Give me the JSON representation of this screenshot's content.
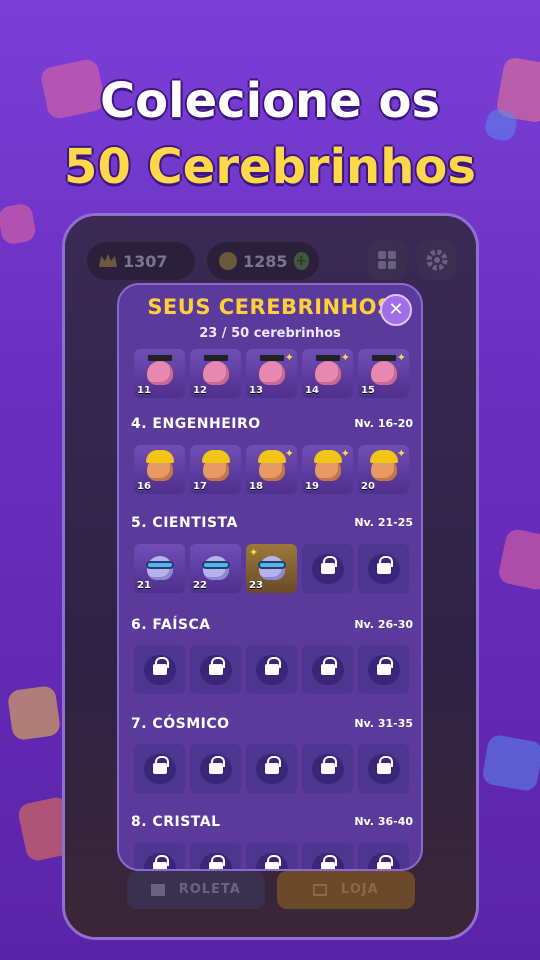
{
  "headline": {
    "line1": "Colecione os",
    "line2": "50 Cerebrinhos"
  },
  "game": {
    "trophies": "1307",
    "coins": "1285",
    "menu_icon": "grid-icon",
    "settings_icon": "gear-icon",
    "bottom_buttons": [
      {
        "label": "ROLETA"
      },
      {
        "label": "LOJA"
      }
    ]
  },
  "modal": {
    "title": "SEUS CEREBRINHOS",
    "count": "23 / 50 cerebrinhos",
    "close_label": "✕",
    "top_row": [
      {
        "num": "11"
      },
      {
        "num": "12"
      },
      {
        "num": "13"
      },
      {
        "num": "14"
      },
      {
        "num": "15"
      }
    ],
    "sections": [
      {
        "name": "4. ENGENHEIRO",
        "levels": "Nv. 16-20",
        "tiles": [
          {
            "num": "16"
          },
          {
            "num": "17"
          },
          {
            "num": "18"
          },
          {
            "num": "19"
          },
          {
            "num": "20"
          }
        ]
      },
      {
        "name": "5. CIENTISTA",
        "levels": "Nv. 21-25",
        "tiles": [
          {
            "num": "21"
          },
          {
            "num": "22"
          },
          {
            "num": "23"
          },
          {
            "num": ""
          },
          {
            "num": ""
          }
        ]
      },
      {
        "name": "6. FAÍSCA",
        "levels": "Nv. 26-30"
      },
      {
        "name": "7. CÓSMICO",
        "levels": "Nv. 31-35"
      },
      {
        "name": "8. CRISTAL",
        "levels": "Nv. 36-40"
      }
    ]
  },
  "colors": {
    "accent_yellow": "#ffcf3a",
    "modal_bg": "#5a3a9a",
    "page_bg": "#7a3fd6"
  }
}
